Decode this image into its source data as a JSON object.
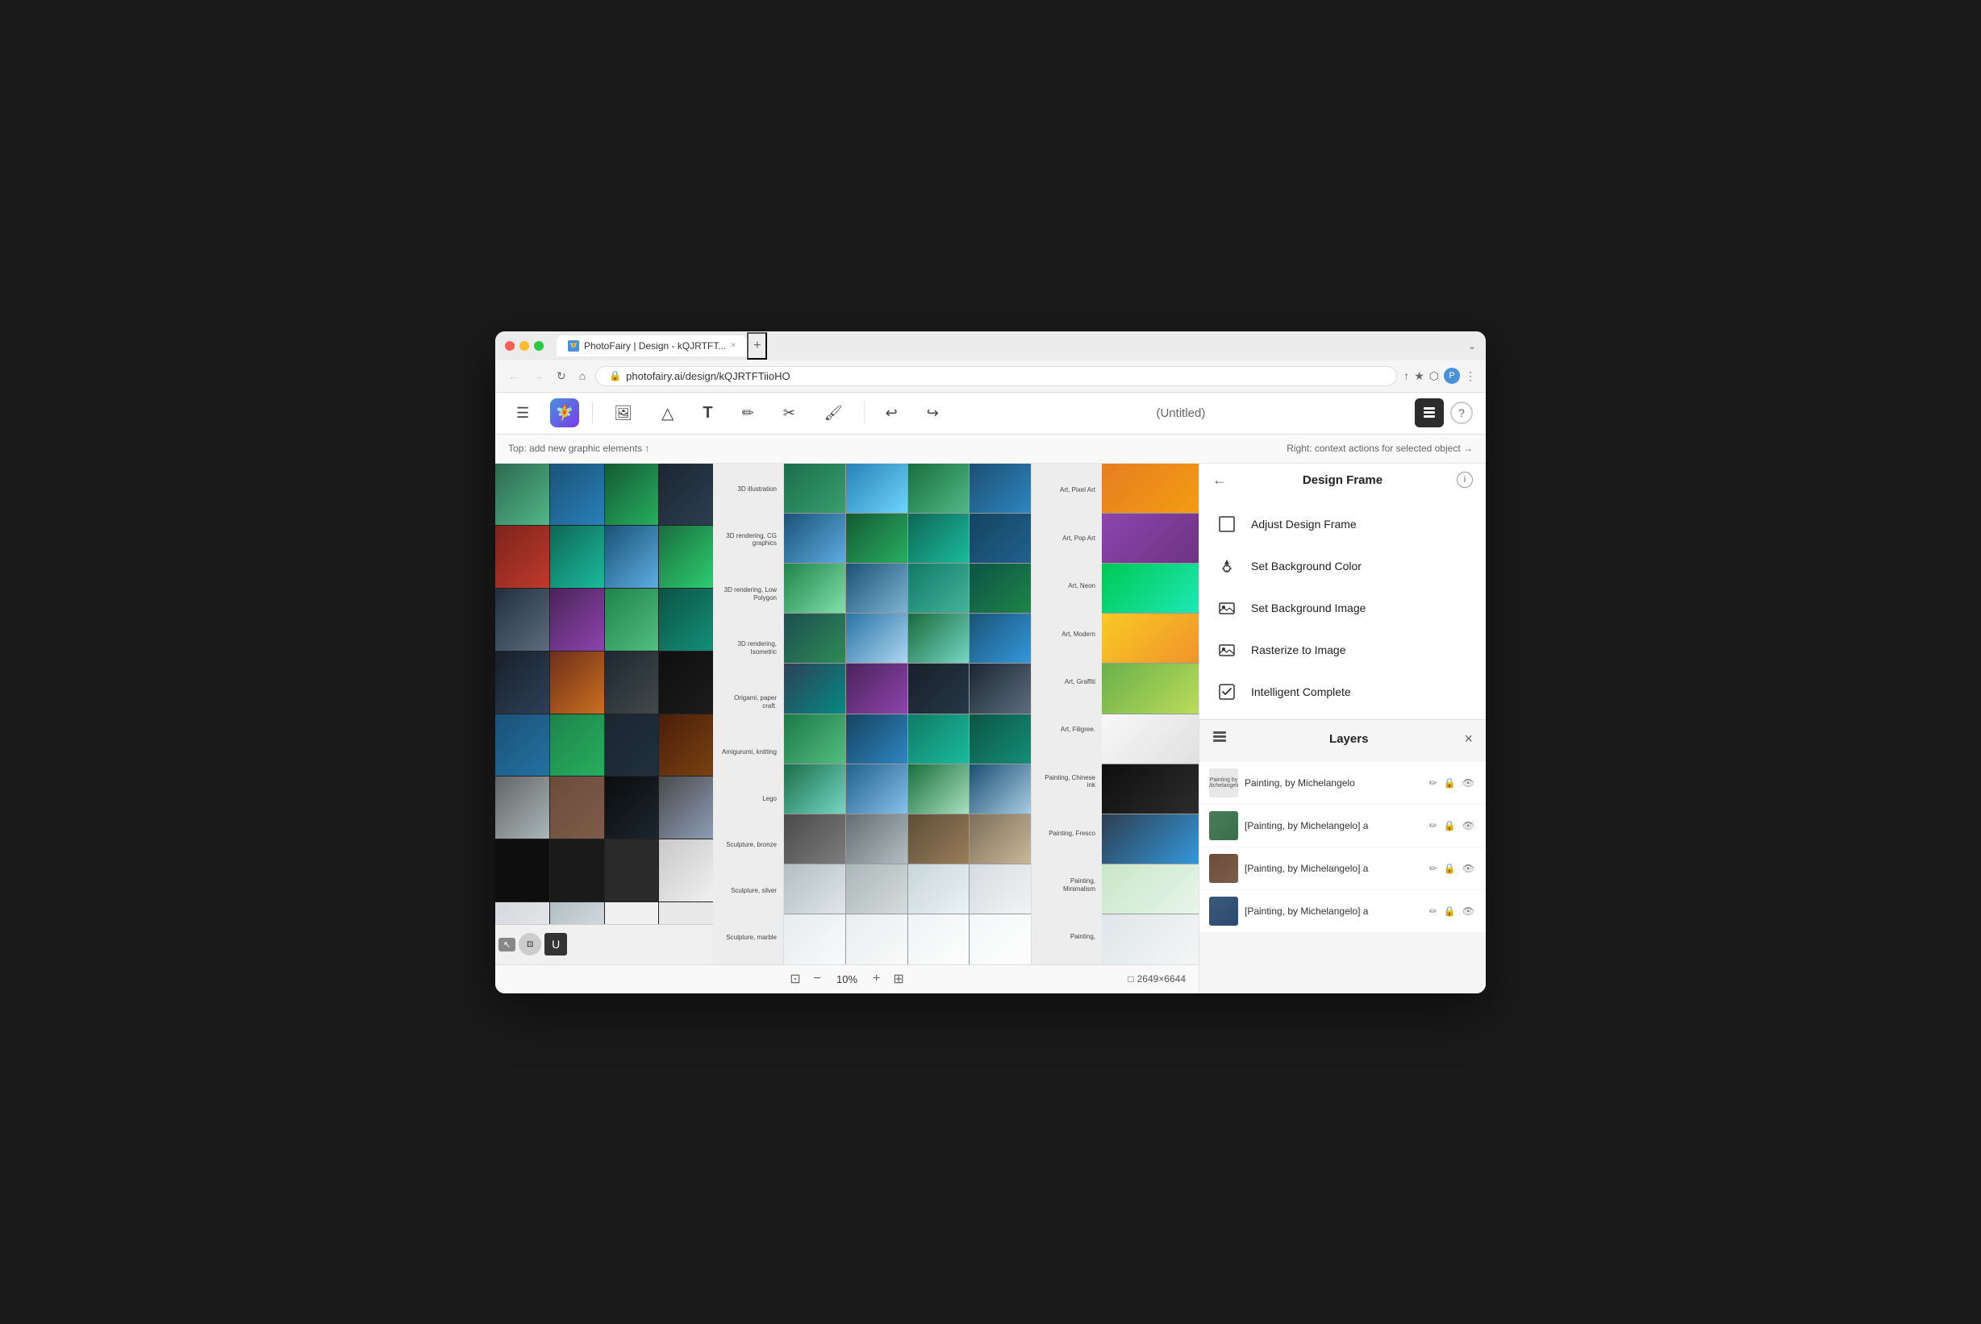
{
  "browser": {
    "tab_title": "PhotoFairy | Design - kQJRTFT...",
    "tab_favicon": "🧚",
    "url": "photofairy.ai/design/kQJRTFTiioHO",
    "new_tab_label": "+",
    "nav": {
      "back": "←",
      "forward": "→",
      "refresh": "↻",
      "home": "⌂"
    },
    "addr_icons": [
      "↑",
      "★",
      "⬡",
      "⬜",
      "P",
      "⋮"
    ]
  },
  "toolbar": {
    "menu_icon": "☰",
    "logo_icon": "🏞",
    "image_tool": "🖼",
    "color_tool": "△",
    "text_tool": "T",
    "pen_tool": "✏",
    "scissor_tool": "✂",
    "brush_tool": "🖌",
    "undo": "↩",
    "redo": "↪",
    "title": "(Untitled)",
    "layers_icon": "≡",
    "help_icon": "?"
  },
  "hints": {
    "left": "Top: add new graphic elements ↑",
    "right": "Right: context actions for selected object →"
  },
  "right_panel": {
    "design_frame": {
      "title": "Design Frame",
      "back_icon": "←",
      "info_icon": "i",
      "actions": [
        {
          "id": "adjust-design-frame",
          "icon": "square",
          "label": "Adjust Design Frame"
        },
        {
          "id": "set-background-color",
          "icon": "fill",
          "label": "Set Background Color"
        },
        {
          "id": "set-background-image",
          "icon": "image",
          "label": "Set Background Image"
        },
        {
          "id": "rasterize-to-image",
          "icon": "image2",
          "label": "Rasterize to Image"
        },
        {
          "id": "intelligent-complete",
          "icon": "checkbox",
          "label": "Intelligent Complete"
        }
      ]
    },
    "layers": {
      "title": "Layers",
      "close_icon": "×",
      "items": [
        {
          "id": 1,
          "name": "Painting, by Michelangelo",
          "has_thumb": false,
          "thumb_text": "Painting, by Michelangelo"
        },
        {
          "id": 2,
          "name": "[Painting, by Michelangelo] a",
          "has_thumb": true,
          "thumb_color": "#4a7c59"
        },
        {
          "id": 3,
          "name": "[Painting, by Michelangelo] a",
          "has_thumb": true,
          "thumb_color": "#6b4c3b"
        },
        {
          "id": 4,
          "name": "[Painting, by Michelangelo] a",
          "has_thumb": true,
          "thumb_color": "#3a5a7c"
        }
      ],
      "action_icons": {
        "edit": "✏",
        "lock": "🔒",
        "visible": "👁"
      }
    }
  },
  "status_bar": {
    "fit_icon": "⊡",
    "zoom_out_icon": "−",
    "zoom_level": "10%",
    "zoom_in_icon": "+",
    "fullscreen_icon": "⊞",
    "dimensions": "2649×6644",
    "dim_icon": "□"
  },
  "bottom_tools": {
    "pointer_tool": "↖",
    "hand_tool": "✋",
    "shape_tool": "⬡"
  },
  "canvas_labels": [
    "3D illustration",
    "3D rendering, CG graphics",
    "3D rendering, Low Polygon",
    "3D rendering, Isometric",
    "Origami, paper craft.",
    "Amigurumi, knitting",
    "Lego",
    "Sculpture, bronze",
    "Sculpture, silver",
    "Sculpture, marble"
  ],
  "canvas_labels_right": [
    "Art, Pixel Art",
    "Art, Pop Art",
    "Art, Neon",
    "Art, Modern",
    "Art, Graffiti",
    "Art, Filigree.",
    "Painting, Chinese ink",
    "Painting, Fresco",
    "Painting, Minimalism",
    "Painting,"
  ],
  "colors": {
    "toolbar_active_bg": "#2c2c2c",
    "panel_bg": "#f5f5f5",
    "action_hover": "#f0f0f0"
  }
}
